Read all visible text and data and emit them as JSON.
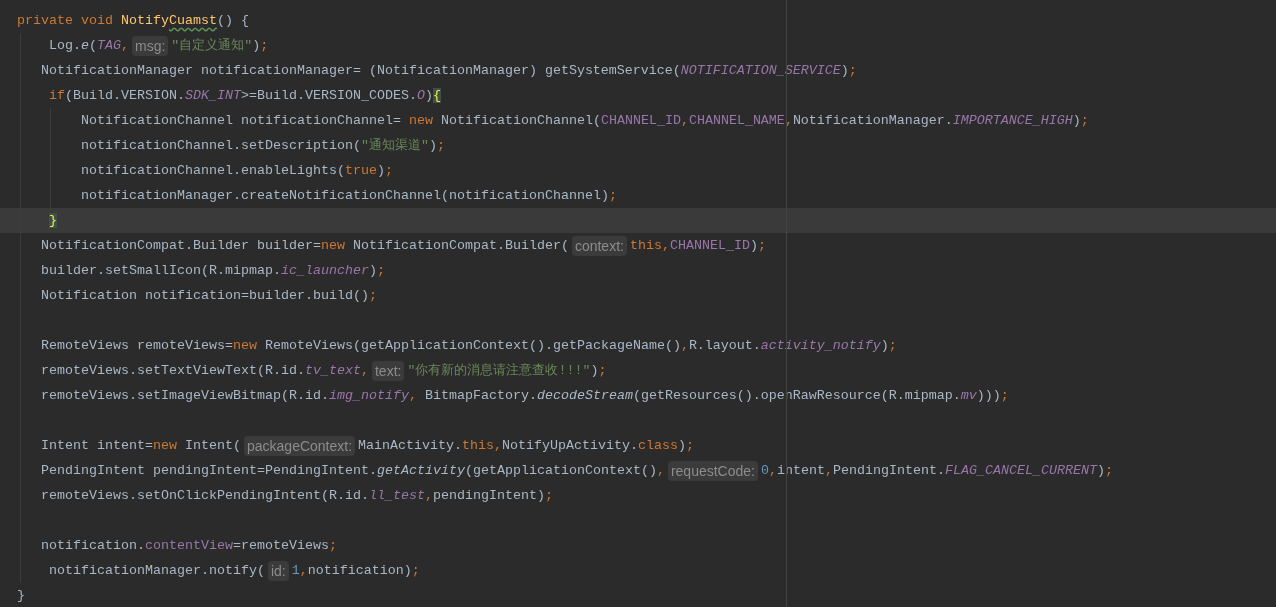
{
  "editor": {
    "lines": [
      {
        "selected": false,
        "segments": [
          {
            "kind": "code",
            "tokens": [
              {
                "kind": "keyword",
                "text": "private void "
              },
              {
                "kind": "method",
                "text": "Notify"
              },
              {
                "kind": "misspelled",
                "text": "Cuamst"
              },
              {
                "kind": "plain",
                "text": "() {"
              }
            ]
          }
        ]
      },
      {
        "selected": false,
        "segments": [
          {
            "kind": "code",
            "tokens": [
              {
                "kind": "plain",
                "text": "    Log."
              },
              {
                "kind": "italic",
                "text": "e"
              },
              {
                "kind": "plain",
                "text": "("
              },
              {
                "kind": "static",
                "text": "TAG"
              },
              {
                "kind": "punct",
                "text": ","
              }
            ]
          },
          {
            "kind": "hint",
            "text": "msg:"
          },
          {
            "kind": "code",
            "tokens": [
              {
                "kind": "string",
                "text": "\"自定义通知\""
              },
              {
                "kind": "plain",
                "text": ")"
              },
              {
                "kind": "punct",
                "text": ";"
              }
            ]
          }
        ]
      },
      {
        "selected": false,
        "segments": [
          {
            "kind": "code",
            "tokens": [
              {
                "kind": "plain",
                "text": "   NotificationManager notificationManager= (NotificationManager) getSystemService("
              },
              {
                "kind": "static",
                "text": "NOTIFICATION_SERVICE"
              },
              {
                "kind": "plain",
                "text": ")"
              },
              {
                "kind": "punct",
                "text": ";"
              }
            ]
          }
        ]
      },
      {
        "selected": false,
        "segments": [
          {
            "kind": "code",
            "tokens": [
              {
                "kind": "keyword",
                "text": "    if"
              },
              {
                "kind": "plain",
                "text": "(Build.VERSION."
              },
              {
                "kind": "static",
                "text": "SDK_INT"
              },
              {
                "kind": "plain",
                "text": ">=Build.VERSION_CODES."
              },
              {
                "kind": "static",
                "text": "O"
              },
              {
                "kind": "plain",
                "text": ")"
              },
              {
                "kind": "brace",
                "text": "{"
              }
            ]
          }
        ]
      },
      {
        "selected": false,
        "segments": [
          {
            "kind": "code",
            "tokens": [
              {
                "kind": "plain",
                "text": "        NotificationChannel notificationChannel= "
              },
              {
                "kind": "keyword",
                "text": "new"
              },
              {
                "kind": "plain",
                "text": " NotificationChannel("
              },
              {
                "kind": "field",
                "text": "CHANNEL_ID"
              },
              {
                "kind": "punct",
                "text": ","
              },
              {
                "kind": "field",
                "text": "CHANNEL_NAME"
              },
              {
                "kind": "punct",
                "text": ","
              },
              {
                "kind": "plain",
                "text": "NotificationManager."
              },
              {
                "kind": "static",
                "text": "IMPORTANCE_HIGH"
              },
              {
                "kind": "plain",
                "text": ")"
              },
              {
                "kind": "punct",
                "text": ";"
              }
            ]
          }
        ]
      },
      {
        "selected": false,
        "segments": [
          {
            "kind": "code",
            "tokens": [
              {
                "kind": "plain",
                "text": "        notificationChannel.setDescription("
              },
              {
                "kind": "string",
                "text": "\"通知渠道\""
              },
              {
                "kind": "plain",
                "text": ")"
              },
              {
                "kind": "punct",
                "text": ";"
              }
            ]
          }
        ]
      },
      {
        "selected": false,
        "segments": [
          {
            "kind": "code",
            "tokens": [
              {
                "kind": "plain",
                "text": "        notificationChannel.enableLights("
              },
              {
                "kind": "keyword",
                "text": "true"
              },
              {
                "kind": "plain",
                "text": ")"
              },
              {
                "kind": "punct",
                "text": ";"
              }
            ]
          }
        ]
      },
      {
        "selected": false,
        "segments": [
          {
            "kind": "code",
            "tokens": [
              {
                "kind": "plain",
                "text": "        notificationManager.createNotificationChannel(notificationChannel)"
              },
              {
                "kind": "punct",
                "text": ";"
              }
            ]
          }
        ]
      },
      {
        "selected": true,
        "segments": [
          {
            "kind": "code",
            "tokens": [
              {
                "kind": "brace",
                "text": "    }"
              }
            ]
          }
        ]
      },
      {
        "selected": false,
        "segments": [
          {
            "kind": "code",
            "tokens": [
              {
                "kind": "plain",
                "text": "   NotificationCompat.Builder builder="
              },
              {
                "kind": "keyword",
                "text": "new"
              },
              {
                "kind": "plain",
                "text": " NotificationCompat.Builder("
              }
            ]
          },
          {
            "kind": "hint",
            "text": "context:"
          },
          {
            "kind": "code",
            "tokens": [
              {
                "kind": "keyword",
                "text": "this"
              },
              {
                "kind": "punct",
                "text": ","
              },
              {
                "kind": "field",
                "text": "CHANNEL_ID"
              },
              {
                "kind": "plain",
                "text": ")"
              },
              {
                "kind": "punct",
                "text": ";"
              }
            ]
          }
        ]
      },
      {
        "selected": false,
        "segments": [
          {
            "kind": "code",
            "tokens": [
              {
                "kind": "plain",
                "text": "   builder.setSmallIcon(R.mipmap."
              },
              {
                "kind": "static",
                "text": "ic_launcher"
              },
              {
                "kind": "plain",
                "text": ")"
              },
              {
                "kind": "punct",
                "text": ";"
              }
            ]
          }
        ]
      },
      {
        "selected": false,
        "segments": [
          {
            "kind": "code",
            "tokens": [
              {
                "kind": "plain",
                "text": "   Notification notification=builder.build()"
              },
              {
                "kind": "punct",
                "text": ";"
              }
            ]
          }
        ]
      },
      {
        "selected": false
      },
      {
        "selected": false,
        "segments": [
          {
            "kind": "code",
            "tokens": [
              {
                "kind": "plain",
                "text": "   RemoteViews remoteViews="
              },
              {
                "kind": "keyword",
                "text": "new"
              },
              {
                "kind": "plain",
                "text": " RemoteViews(getApplicationContext().getPackageName()"
              },
              {
                "kind": "punct",
                "text": ","
              },
              {
                "kind": "plain",
                "text": "R.layout."
              },
              {
                "kind": "static",
                "text": "activity_notify"
              },
              {
                "kind": "plain",
                "text": ")"
              },
              {
                "kind": "punct",
                "text": ";"
              }
            ]
          }
        ]
      },
      {
        "selected": false,
        "segments": [
          {
            "kind": "code",
            "tokens": [
              {
                "kind": "plain",
                "text": "   remoteViews.setTextViewText(R.id."
              },
              {
                "kind": "static",
                "text": "tv_text"
              },
              {
                "kind": "punct",
                "text": ","
              }
            ]
          },
          {
            "kind": "hint",
            "text": "text:"
          },
          {
            "kind": "code",
            "tokens": [
              {
                "kind": "string",
                "text": "\"你有新的消息请注意查收!!!\""
              },
              {
                "kind": "plain",
                "text": ")"
              },
              {
                "kind": "punct",
                "text": ";"
              }
            ]
          }
        ]
      },
      {
        "selected": false,
        "segments": [
          {
            "kind": "code",
            "tokens": [
              {
                "kind": "plain",
                "text": "   remoteViews.setImageViewBitmap(R.id."
              },
              {
                "kind": "static",
                "text": "img_notify"
              },
              {
                "kind": "punct",
                "text": ","
              },
              {
                "kind": "plain",
                "text": " BitmapFactory."
              },
              {
                "kind": "italic",
                "text": "decodeStream"
              },
              {
                "kind": "plain",
                "text": "(getResources().openRawResource(R.mipmap."
              },
              {
                "kind": "static",
                "text": "mv"
              },
              {
                "kind": "plain",
                "text": ")))"
              },
              {
                "kind": "punct",
                "text": ";"
              }
            ]
          }
        ]
      },
      {
        "selected": false
      },
      {
        "selected": false,
        "segments": [
          {
            "kind": "code",
            "tokens": [
              {
                "kind": "plain",
                "text": "   Intent intent="
              },
              {
                "kind": "keyword",
                "text": "new"
              },
              {
                "kind": "plain",
                "text": " Intent("
              }
            ]
          },
          {
            "kind": "hint",
            "text": "packageContext:"
          },
          {
            "kind": "code",
            "tokens": [
              {
                "kind": "plain",
                "text": "MainActivity."
              },
              {
                "kind": "keyword",
                "text": "this"
              },
              {
                "kind": "punct",
                "text": ","
              },
              {
                "kind": "plain",
                "text": "NotifyUpActivity."
              },
              {
                "kind": "keyword",
                "text": "class"
              },
              {
                "kind": "plain",
                "text": ")"
              },
              {
                "kind": "punct",
                "text": ";"
              }
            ]
          }
        ]
      },
      {
        "selected": false,
        "segments": [
          {
            "kind": "code",
            "tokens": [
              {
                "kind": "plain",
                "text": "   PendingIntent pendingIntent=PendingIntent."
              },
              {
                "kind": "italic",
                "text": "getActivity"
              },
              {
                "kind": "plain",
                "text": "(getApplicationContext()"
              },
              {
                "kind": "punct",
                "text": ","
              }
            ]
          },
          {
            "kind": "hint",
            "text": "requestCode:"
          },
          {
            "kind": "code",
            "tokens": [
              {
                "kind": "number",
                "text": "0"
              },
              {
                "kind": "punct",
                "text": ","
              },
              {
                "kind": "plain",
                "text": "intent"
              },
              {
                "kind": "punct",
                "text": ","
              },
              {
                "kind": "plain",
                "text": "PendingIntent."
              },
              {
                "kind": "static",
                "text": "FLAG_CANCEL_CURRENT"
              },
              {
                "kind": "plain",
                "text": ")"
              },
              {
                "kind": "punct",
                "text": ";"
              }
            ]
          }
        ]
      },
      {
        "selected": false,
        "segments": [
          {
            "kind": "code",
            "tokens": [
              {
                "kind": "plain",
                "text": "   remoteViews.setOnClickPendingIntent(R.id."
              },
              {
                "kind": "static",
                "text": "ll_test"
              },
              {
                "kind": "punct",
                "text": ","
              },
              {
                "kind": "plain",
                "text": "pendingIntent)"
              },
              {
                "kind": "punct",
                "text": ";"
              }
            ]
          }
        ]
      },
      {
        "selected": false
      },
      {
        "selected": false,
        "segments": [
          {
            "kind": "code",
            "tokens": [
              {
                "kind": "plain",
                "text": "   notification."
              },
              {
                "kind": "field",
                "text": "contentView"
              },
              {
                "kind": "plain",
                "text": "=remoteViews"
              },
              {
                "kind": "punct",
                "text": ";"
              }
            ]
          }
        ]
      },
      {
        "selected": false,
        "segments": [
          {
            "kind": "code",
            "tokens": [
              {
                "kind": "plain",
                "text": "    notificationManager.notify("
              }
            ]
          },
          {
            "kind": "hint",
            "text": "id:"
          },
          {
            "kind": "code",
            "tokens": [
              {
                "kind": "number",
                "text": "1"
              },
              {
                "kind": "punct",
                "text": ","
              },
              {
                "kind": "plain",
                "text": "notification)"
              },
              {
                "kind": "punct",
                "text": ";"
              }
            ]
          }
        ]
      },
      {
        "selected": false,
        "segments": [
          {
            "kind": "code",
            "tokens": [
              {
                "kind": "plain",
                "text": "}"
              }
            ]
          }
        ]
      }
    ]
  }
}
